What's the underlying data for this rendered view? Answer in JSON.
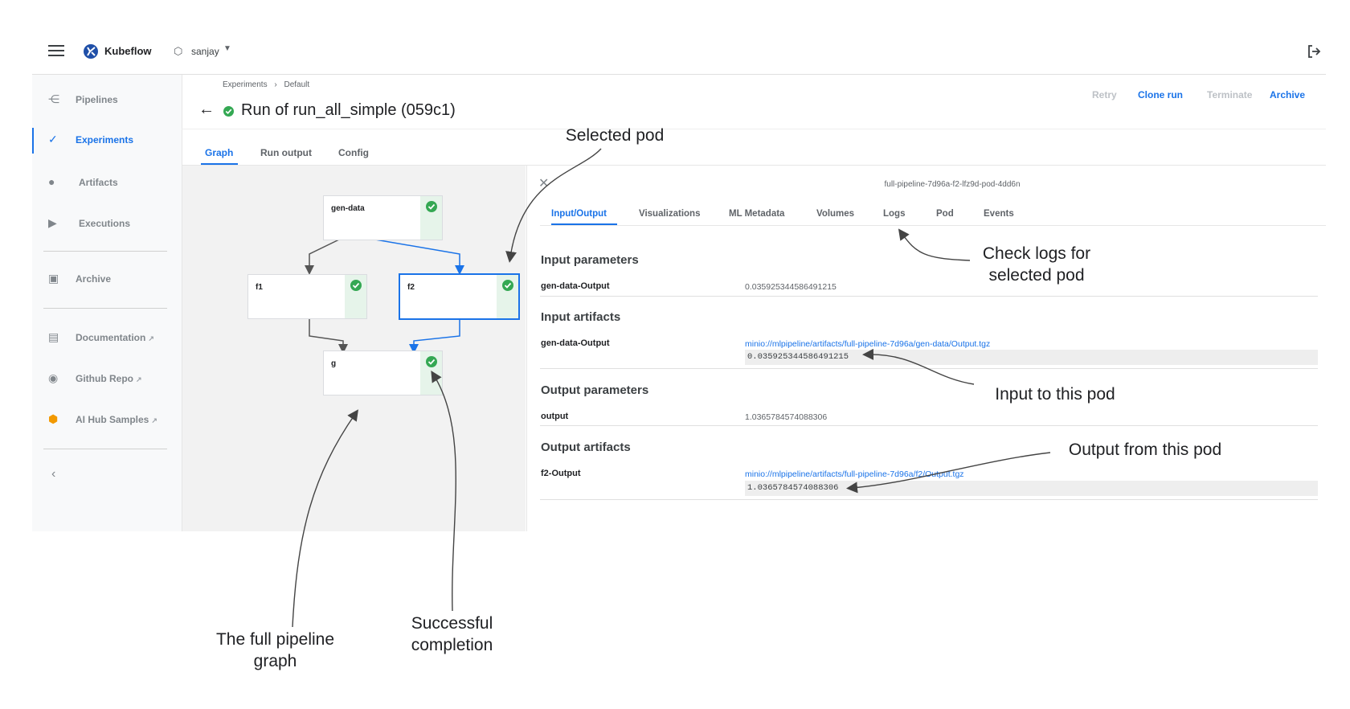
{
  "app": {
    "brand": "Kubeflow",
    "namespace": "sanjay"
  },
  "sidebar": {
    "items": [
      {
        "label": "Pipelines",
        "icon": "pipelines-icon"
      },
      {
        "label": "Experiments",
        "icon": "experiments-icon",
        "active": true
      },
      {
        "label": "Artifacts",
        "icon": "artifacts-icon"
      },
      {
        "label": "Executions",
        "icon": "executions-icon"
      },
      {
        "label": "Archive",
        "icon": "archive-icon"
      },
      {
        "label": "Documentation",
        "icon": "document-icon",
        "external": true
      },
      {
        "label": "Github Repo",
        "icon": "github-icon",
        "external": true
      },
      {
        "label": "AI Hub Samples",
        "icon": "ai-hub-icon",
        "external": true
      }
    ]
  },
  "breadcrumb": [
    "Experiments",
    "›",
    "Default"
  ],
  "run": {
    "title": "Run of run_all_simple (059c1)"
  },
  "actions": {
    "retry": "Retry",
    "clone": "Clone run",
    "terminate": "Terminate",
    "archive": "Archive"
  },
  "tabs": [
    "Graph",
    "Run output",
    "Config"
  ],
  "graph": {
    "nodes": [
      "gen-data",
      "f1",
      "f2",
      "g"
    ]
  },
  "details": {
    "pod_name": "full-pipeline-7d96a-f2-lfz9d-pod-4dd6n",
    "tabs": [
      "Input/Output",
      "Visualizations",
      "ML Metadata",
      "Volumes",
      "Logs",
      "Pod",
      "Events"
    ],
    "input_parameters": {
      "title": "Input parameters",
      "key": "gen-data-Output",
      "value": "0.035925344586491215"
    },
    "input_artifacts": {
      "title": "Input artifacts",
      "key": "gen-data-Output",
      "link": "minio://mlpipeline/artifacts/full-pipeline-7d96a/gen-data/Output.tgz",
      "preview": "0.035925344586491215"
    },
    "output_parameters": {
      "title": "Output parameters",
      "key": "output",
      "value": "1.0365784574088306"
    },
    "output_artifacts": {
      "title": "Output artifacts",
      "key": "f2-Output",
      "link": "minio://mlpipeline/artifacts/full-pipeline-7d96a/f2/Output.tgz",
      "preview": "1.0365784574088306"
    }
  },
  "annotations": {
    "selected_pod": "Selected pod",
    "check_logs_1": "Check logs for",
    "check_logs_2": "selected pod",
    "input_to_pod": "Input to this pod",
    "output_from_pod": "Output from this pod",
    "full_graph_1": "The full pipeline",
    "full_graph_2": "graph",
    "success_1": "Successful",
    "success_2": "completion"
  },
  "colors": {
    "accent": "#1a73e8",
    "success": "#34a853",
    "sidebar_bg": "#f8f9fa",
    "graph_bg": "#f2f2f2"
  }
}
